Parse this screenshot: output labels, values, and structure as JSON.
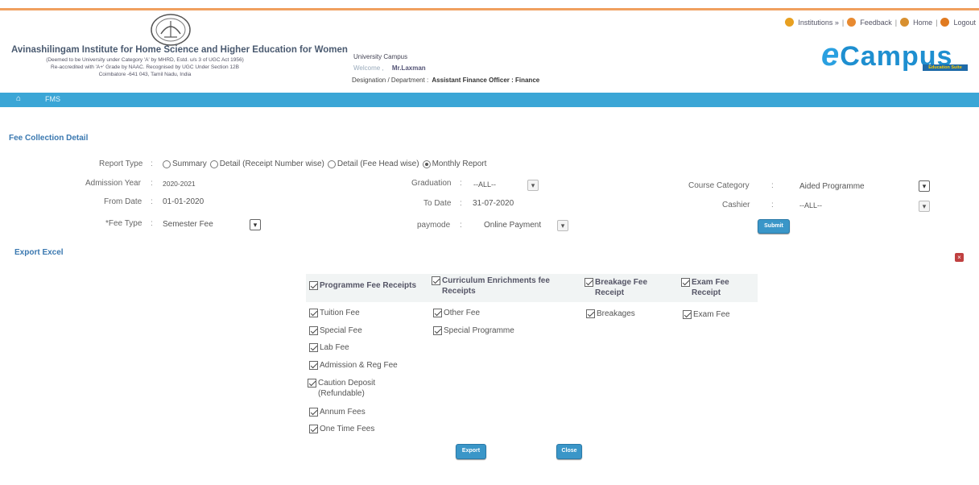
{
  "header": {
    "institute_name": "Avinashilingam Institute for Home Science and Higher Education for Women",
    "institute_line1": "(Deemed to be University under Category 'A' by MHRD, Estd. u/s 3 of UGC Act 1956)",
    "institute_line2": "Re-accredited with 'A+' Grade by NAAC. Recognised by UGC Under Section 12B",
    "institute_line3": "Coimbatore -641 043, Tamil Nadu, India",
    "campus": "University Campus",
    "user_label": "Welcome ,",
    "user_name": "Mr.Laxman",
    "designation_label": "Designation / Department :",
    "designation_value": "Assistant Finance Officer : Finance",
    "links": {
      "institutions": "Institutions »",
      "feedback": "Feedback",
      "home": "Home",
      "logout": "Logout"
    },
    "brand": "Campus",
    "brand_e": "e",
    "brand_tag": "Education Suite",
    "accent": "#3ba6d6"
  },
  "nav": {
    "fms": "FMS"
  },
  "page_title": "Fee Collection Detail",
  "form": {
    "report_type_label": "Report Type",
    "report_types": [
      "Summary",
      "Detail (Receipt Number wise)",
      "Detail (Fee Head wise)",
      "Monthly Report"
    ],
    "report_type_selected": "Monthly Report",
    "admission_year_label": "Admission Year",
    "admission_year": "2020-2021",
    "from_date_label": "From Date",
    "from_date": "01-01-2020",
    "fee_type_label": "*Fee Type",
    "fee_type": "Semester Fee",
    "graduation_label": "Graduation",
    "graduation": "--ALL--",
    "to_date_label": "To Date",
    "to_date": "31-07-2020",
    "paymode_label": "paymode",
    "paymode": "Online Payment",
    "course_category_label": "Course Category",
    "course_category": "Aided Programme",
    "cashier_label": "Cashier",
    "cashier": "--ALL--",
    "submit_label": "Submit",
    "colon": ":"
  },
  "export_excel": "Export Excel",
  "fee_groups": {
    "programme_header": "Programme Fee Receipts",
    "curriculum_header": "Curriculum Enrichments fee Receipts",
    "breakage_header": "Breakage Fee Receipt",
    "exam_header": "Exam Fee Receipt",
    "programme_items": [
      "Tuition Fee",
      "Special Fee",
      "Lab Fee",
      "Admission & Reg Fee",
      "Caution Deposit (Refundable)",
      "Annum Fees",
      "One Time Fees"
    ],
    "curriculum_items": [
      "Other Fee",
      "Special Programme"
    ],
    "breakage_items": [
      "Breakages"
    ],
    "exam_items": [
      "Exam Fee"
    ]
  },
  "buttons": {
    "export": "Export",
    "close": "Close"
  }
}
